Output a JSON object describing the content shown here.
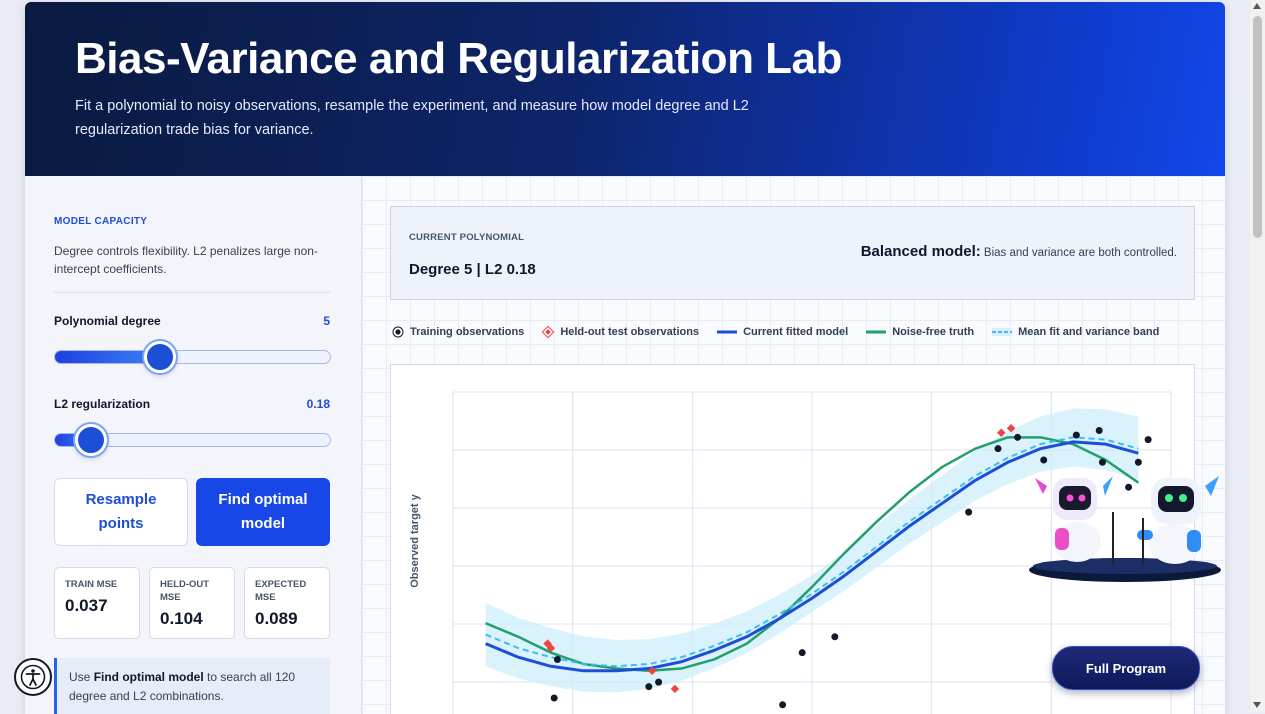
{
  "header": {
    "title": "Bias-Variance and Regularization Lab",
    "subtitle": "Fit a polynomial to noisy observations, resample the experiment, and measure how model degree and L2 regularization trade bias for variance."
  },
  "sidebar": {
    "section_title": "MODEL CAPACITY",
    "section_desc": "Degree controls flexibility. L2 penalizes large non-intercept coefficients.",
    "degree": {
      "label": "Polynomial degree",
      "value": "5",
      "fraction": 0.38
    },
    "l2": {
      "label": "L2 regularization",
      "value": "0.18",
      "fraction": 0.13
    },
    "resample_label": "Resample points",
    "optimal_label": "Find optimal model",
    "metrics": [
      {
        "label": "TRAIN MSE",
        "value": "0.037"
      },
      {
        "label": "HELD-OUT MSE",
        "value": "0.104"
      },
      {
        "label": "EXPECTED MSE",
        "value": "0.089"
      }
    ],
    "hint": {
      "prefix": "Use ",
      "bold": "Find optimal model",
      "suffix": " to search all 120 degree and L2 combinations."
    }
  },
  "main": {
    "status": {
      "label": "CURRENT POLYNOMIAL",
      "value": "Degree 5 | L2 0.18",
      "verdict_bold": "Balanced model:",
      "verdict_text": " Bias and variance are both controlled."
    },
    "legend": [
      {
        "label": "Training observations",
        "icon": "training-dot-icon"
      },
      {
        "label": "Held-out test observations",
        "icon": "test-diamond-icon"
      },
      {
        "label": "Current fitted model",
        "icon": "fit-line-icon"
      },
      {
        "label": "Noise-free truth",
        "icon": "truth-line-icon"
      },
      {
        "label": "Mean fit and variance band",
        "icon": "mean-dashed-icon"
      }
    ],
    "ylabel": "Observed target y",
    "full_program_label": "Full Program"
  },
  "colors": {
    "accent": "#1747e6",
    "fit": "#1d4ed8",
    "truth": "#22a06b",
    "mean": "#38bdf8",
    "test": "#ef4444",
    "train": "#111827"
  },
  "chart_data": {
    "type": "scatter",
    "xlabel": "",
    "ylabel": "Observed target y",
    "grid": true,
    "legend_position": "top",
    "series": [
      {
        "name": "Training observations",
        "x": [
          -0.78,
          -0.79,
          -0.5,
          -0.47,
          -0.09,
          -0.03,
          0.07,
          0.48,
          0.57,
          0.63,
          0.71,
          0.81,
          0.88,
          0.89,
          1.03,
          1.0,
          0.97
        ],
        "y": [
          -0.43,
          -0.6,
          -0.55,
          -0.53,
          -0.63,
          -0.4,
          -0.33,
          0.22,
          0.5,
          0.55,
          0.45,
          0.56,
          0.58,
          0.44,
          0.54,
          0.44,
          0.33
        ]
      },
      {
        "name": "Held-out test observations",
        "x": [
          -0.81,
          -0.8,
          -0.49,
          -0.42,
          0.58,
          0.61
        ],
        "y": [
          -0.36,
          -0.38,
          -0.48,
          -0.56,
          0.57,
          0.59
        ]
      },
      {
        "name": "Current fitted model",
        "x": [
          -1.0,
          -0.9,
          -0.8,
          -0.7,
          -0.6,
          -0.5,
          -0.4,
          -0.3,
          -0.2,
          -0.1,
          0.0,
          0.1,
          0.2,
          0.3,
          0.4,
          0.5,
          0.6,
          0.7,
          0.8,
          0.9,
          1.0
        ],
        "y": [
          -0.36,
          -0.42,
          -0.46,
          -0.48,
          -0.48,
          -0.47,
          -0.44,
          -0.39,
          -0.33,
          -0.25,
          -0.16,
          -0.06,
          0.05,
          0.16,
          0.26,
          0.36,
          0.44,
          0.5,
          0.53,
          0.52,
          0.48
        ]
      },
      {
        "name": "Noise-free truth",
        "x": [
          -1.0,
          -0.9,
          -0.8,
          -0.7,
          -0.6,
          -0.5,
          -0.4,
          -0.3,
          -0.2,
          -0.1,
          0.0,
          0.1,
          0.2,
          0.3,
          0.4,
          0.5,
          0.6,
          0.7,
          0.8,
          0.9,
          1.0
        ],
        "y": [
          -0.27,
          -0.33,
          -0.4,
          -0.45,
          -0.47,
          -0.48,
          -0.47,
          -0.43,
          -0.36,
          -0.25,
          -0.11,
          0.04,
          0.18,
          0.31,
          0.42,
          0.5,
          0.55,
          0.55,
          0.52,
          0.45,
          0.35
        ]
      },
      {
        "name": "Mean fit and variance band",
        "x": [
          -1.0,
          -0.9,
          -0.8,
          -0.7,
          -0.6,
          -0.5,
          -0.4,
          -0.3,
          -0.2,
          -0.1,
          0.0,
          0.1,
          0.2,
          0.3,
          0.4,
          0.5,
          0.6,
          0.7,
          0.8,
          0.9,
          1.0
        ],
        "y": [
          -0.32,
          -0.38,
          -0.42,
          -0.45,
          -0.46,
          -0.45,
          -0.42,
          -0.37,
          -0.31,
          -0.23,
          -0.14,
          -0.04,
          0.07,
          0.18,
          0.28,
          0.38,
          0.46,
          0.52,
          0.55,
          0.54,
          0.5
        ]
      }
    ],
    "xlim": [
      -1.1,
      1.1
    ],
    "ylim": [
      -0.75,
      0.75
    ]
  }
}
